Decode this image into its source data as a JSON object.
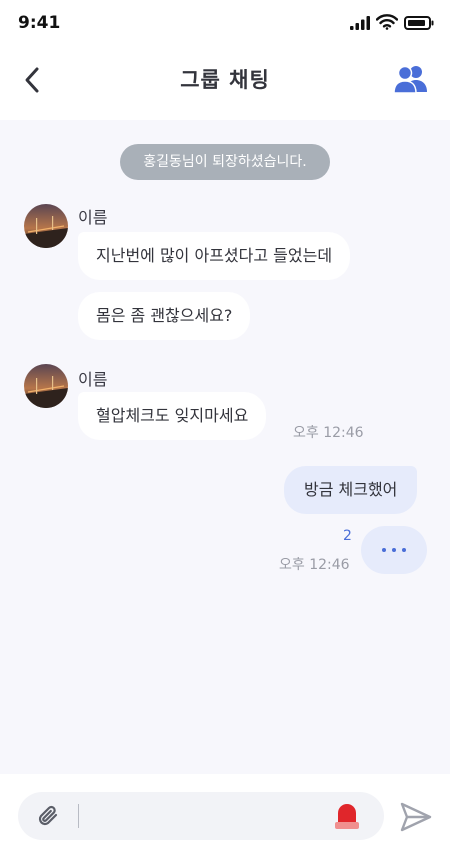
{
  "status_bar": {
    "time": "9:41"
  },
  "header": {
    "title": "그룹 채팅",
    "back_icon": "chevron-left-icon",
    "members_icon": "users-icon",
    "accent_color": "#4a6ed8"
  },
  "notice": "홍길동님이 퇴장하셨습니다.",
  "messages": [
    {
      "direction": "incoming",
      "sender": "이름",
      "lines": [
        "지난번에 많이 아프셨다고 들었는데",
        "몸은 좀 괜찮으세요?"
      ]
    },
    {
      "direction": "incoming",
      "sender": "이름",
      "lines": [
        "혈압체크도 잊지마세요"
      ],
      "time": "오후 12:46"
    },
    {
      "direction": "outgoing",
      "lines": [
        "방금 체크했어"
      ],
      "unread_count": "2",
      "time": "오후 12:46"
    }
  ],
  "typing_indicator": "more-dots-icon",
  "input": {
    "value": "",
    "attach_icon": "paperclip-icon",
    "emergency_icon": "siren-icon",
    "send_icon": "send-icon"
  },
  "colors": {
    "chat_background": "#f7f7fc",
    "outgoing_bubble": "#e6ebfb",
    "notice_background": "#a9b0b8",
    "emergency": "#e0262b"
  }
}
